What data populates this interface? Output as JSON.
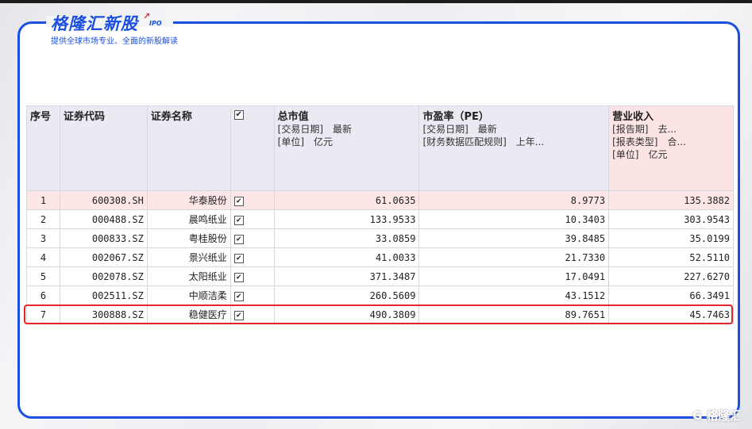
{
  "brand": {
    "title": "格隆汇新股",
    "tag": "IPO",
    "subtitle": "提供全球市场专业、全面的新股解读",
    "watermark": "格隆汇"
  },
  "table": {
    "headers": {
      "seq": "序号",
      "code": "证券代码",
      "name": "证券名称",
      "mcap": {
        "title": "总市值",
        "lines": [
          "[交易日期]　最新",
          "[单位]　亿元"
        ]
      },
      "pe": {
        "title": "市盈率（PE）",
        "lines": [
          "[交易日期]　最新",
          "[财务数据匹配规则]　上年..."
        ]
      },
      "rev": {
        "title": "营业收入",
        "lines": [
          "[报告期]　去...",
          "[报表类型]　合...",
          "[单位]　亿元"
        ]
      }
    },
    "rows": [
      {
        "seq": "1",
        "code": "600308.SH",
        "name": "华泰股份",
        "mcap": "61.0635",
        "pe": "8.9773",
        "rev": "135.3882"
      },
      {
        "seq": "2",
        "code": "000488.SZ",
        "name": "晨鸣纸业",
        "mcap": "133.9533",
        "pe": "10.3403",
        "rev": "303.9543"
      },
      {
        "seq": "3",
        "code": "000833.SZ",
        "name": "粤桂股份",
        "mcap": "33.0859",
        "pe": "39.8485",
        "rev": "35.0199"
      },
      {
        "seq": "4",
        "code": "002067.SZ",
        "name": "景兴纸业",
        "mcap": "41.0033",
        "pe": "21.7330",
        "rev": "52.5110"
      },
      {
        "seq": "5",
        "code": "002078.SZ",
        "name": "太阳纸业",
        "mcap": "371.3487",
        "pe": "17.0491",
        "rev": "227.6270"
      },
      {
        "seq": "6",
        "code": "002511.SZ",
        "name": "中顺洁柔",
        "mcap": "260.5609",
        "pe": "43.1512",
        "rev": "66.3491"
      },
      {
        "seq": "7",
        "code": "300888.SZ",
        "name": "稳健医疗",
        "mcap": "490.3809",
        "pe": "89.7651",
        "rev": "45.7463"
      }
    ]
  },
  "colors": {
    "accent": "#1a4fe0",
    "highlight": "#e8232a"
  }
}
